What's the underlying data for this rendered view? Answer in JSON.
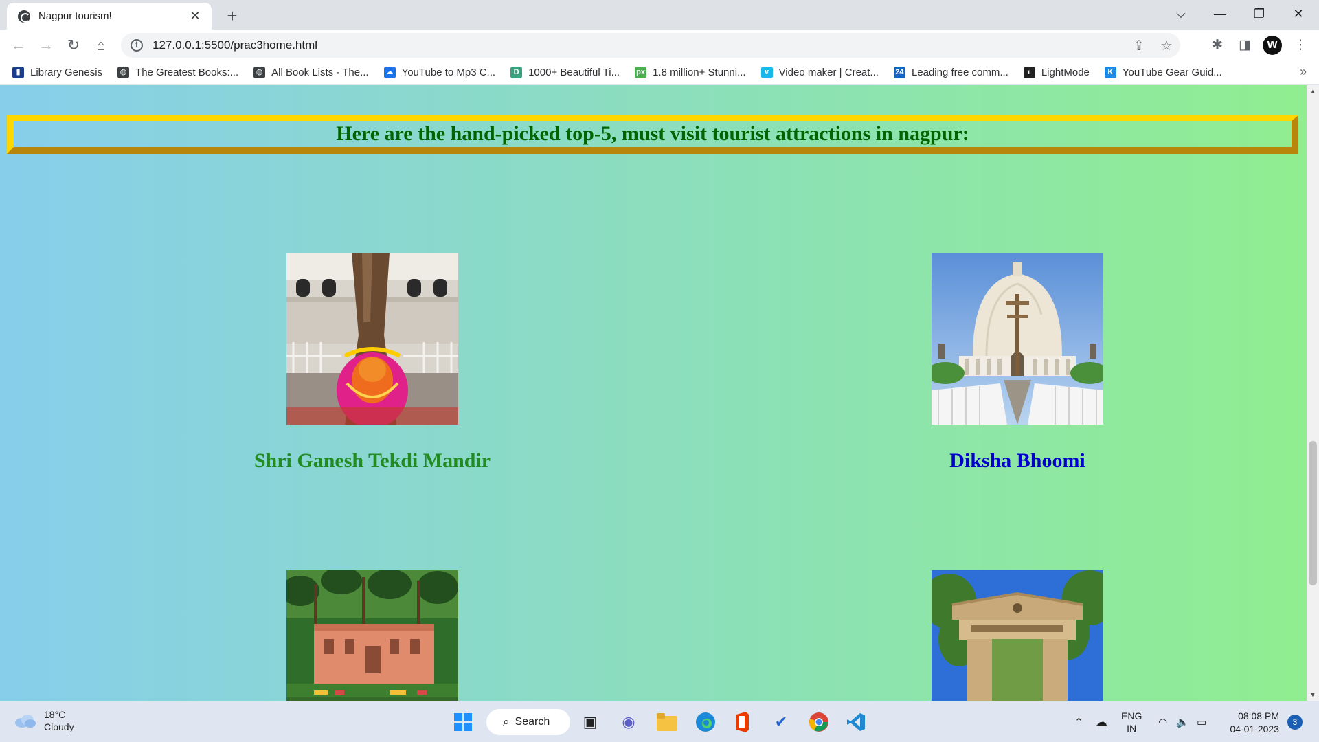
{
  "browser": {
    "tab_title": "Nagpur tourism!",
    "tab_close": "✕",
    "new_tab": "+",
    "url": "127.0.0.1:5500/prac3home.html",
    "window_controls": {
      "dropdown": "⌵",
      "minimize": "—",
      "restore": "❐",
      "close": "✕"
    }
  },
  "bookmarks": [
    {
      "label": "Library Genesis",
      "icon": "library-icon",
      "color": "#1a3c8a"
    },
    {
      "label": "The Greatest Books:...",
      "icon": "globe-icon",
      "color": "#3c4043"
    },
    {
      "label": "All Book Lists - The...",
      "icon": "globe-icon",
      "color": "#3c4043"
    },
    {
      "label": "YouTube to Mp3 C...",
      "icon": "cloud-download-icon",
      "color": "#1a73e8"
    },
    {
      "label": "1000+ Beautiful Ti...",
      "icon": "d-icon",
      "color": "#3aa17e"
    },
    {
      "label": "1.8 million+ Stunni...",
      "icon": "px-icon",
      "color": "#4caf50"
    },
    {
      "label": "Video maker | Creat...",
      "icon": "vimeo-icon",
      "color": "#1ab7ea"
    },
    {
      "label": "Leading free comm...",
      "icon": "24-icon",
      "color": "#1565c0"
    },
    {
      "label": "LightMode",
      "icon": "lightmode-icon",
      "color": "#222222"
    },
    {
      "label": "YouTube Gear Guid...",
      "icon": "kit-icon",
      "color": "#1e88e5"
    }
  ],
  "page": {
    "banner": "Here are the hand-picked top-5, must visit tourist attractions in nagpur:",
    "colors": {
      "gradient_start": "#87ceeb",
      "gradient_end": "#90ee90",
      "banner_text": "#006400",
      "border_light": "#ffd700",
      "border_dark": "#b8860b"
    },
    "attractions": [
      {
        "name": "Shri Ganesh Tekdi Mandir",
        "color": "#228b22"
      },
      {
        "name": "Diksha Bhoomi",
        "color": "#0000cd"
      },
      {
        "name": ""
      },
      {
        "name": ""
      }
    ]
  },
  "taskbar": {
    "temperature": "18°C",
    "condition": "Cloudy",
    "search_label": "Search",
    "language": "ENG",
    "region": "IN",
    "time": "08:08 PM",
    "date": "04-01-2023",
    "notifications": "3"
  }
}
